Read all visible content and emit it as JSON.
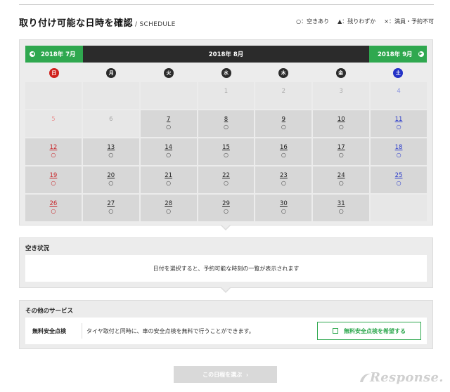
{
  "header": {
    "title": "取り付け可能な日時を確認",
    "subtitle": "/ SCHEDULE",
    "legend": [
      "○：空きあり",
      "▲：残りわずか",
      "×：満員・予約不可"
    ]
  },
  "calendar": {
    "prev_month": "2018年 7月",
    "current_month": "2018年 8月",
    "next_month": "2018年 9月",
    "weekdays": [
      "日",
      "月",
      "火",
      "水",
      "木",
      "金",
      "土"
    ],
    "weeks": [
      [
        {
          "day": "",
          "status": "",
          "kind": "empty"
        },
        {
          "day": "",
          "status": "",
          "kind": "empty"
        },
        {
          "day": "",
          "status": "",
          "kind": "empty"
        },
        {
          "day": "1",
          "status": "",
          "kind": "past"
        },
        {
          "day": "2",
          "status": "",
          "kind": "past"
        },
        {
          "day": "3",
          "status": "",
          "kind": "past"
        },
        {
          "day": "4",
          "status": "",
          "kind": "past"
        }
      ],
      [
        {
          "day": "5",
          "status": "",
          "kind": "past"
        },
        {
          "day": "6",
          "status": "",
          "kind": "past"
        },
        {
          "day": "7",
          "status": "○",
          "kind": "open"
        },
        {
          "day": "8",
          "status": "○",
          "kind": "open"
        },
        {
          "day": "9",
          "status": "○",
          "kind": "open"
        },
        {
          "day": "10",
          "status": "○",
          "kind": "open"
        },
        {
          "day": "11",
          "status": "○",
          "kind": "open"
        }
      ],
      [
        {
          "day": "12",
          "status": "○",
          "kind": "open"
        },
        {
          "day": "13",
          "status": "○",
          "kind": "open"
        },
        {
          "day": "14",
          "status": "○",
          "kind": "open"
        },
        {
          "day": "15",
          "status": "○",
          "kind": "open"
        },
        {
          "day": "16",
          "status": "○",
          "kind": "open"
        },
        {
          "day": "17",
          "status": "○",
          "kind": "open"
        },
        {
          "day": "18",
          "status": "○",
          "kind": "open"
        }
      ],
      [
        {
          "day": "19",
          "status": "○",
          "kind": "open"
        },
        {
          "day": "20",
          "status": "○",
          "kind": "open"
        },
        {
          "day": "21",
          "status": "○",
          "kind": "open"
        },
        {
          "day": "22",
          "status": "○",
          "kind": "open"
        },
        {
          "day": "23",
          "status": "○",
          "kind": "open"
        },
        {
          "day": "24",
          "status": "○",
          "kind": "open"
        },
        {
          "day": "25",
          "status": "○",
          "kind": "open"
        }
      ],
      [
        {
          "day": "26",
          "status": "○",
          "kind": "open"
        },
        {
          "day": "27",
          "status": "○",
          "kind": "open"
        },
        {
          "day": "28",
          "status": "○",
          "kind": "open"
        },
        {
          "day": "29",
          "status": "○",
          "kind": "open"
        },
        {
          "day": "30",
          "status": "○",
          "kind": "open"
        },
        {
          "day": "31",
          "status": "○",
          "kind": "open"
        },
        {
          "day": "",
          "status": "",
          "kind": "empty"
        }
      ]
    ]
  },
  "availability": {
    "title": "空き状況",
    "message": "日付を選択すると、予約可能な時刻の一覧が表示されます"
  },
  "services": {
    "title": "その他のサービス",
    "label": "無料安全点検",
    "description": "タイヤ取付と同時に、車の安全点検を無料で行うことができます。",
    "button": "無料安全点検を希望する"
  },
  "footer": {
    "select_button": "この日程を選ぶ",
    "logo_text": "Response."
  },
  "colors": {
    "accent_green": "#2fa84f",
    "sunday_red": "#d0211c",
    "saturday_blue": "#2432c6",
    "dark_bar": "#2b2b2b"
  }
}
